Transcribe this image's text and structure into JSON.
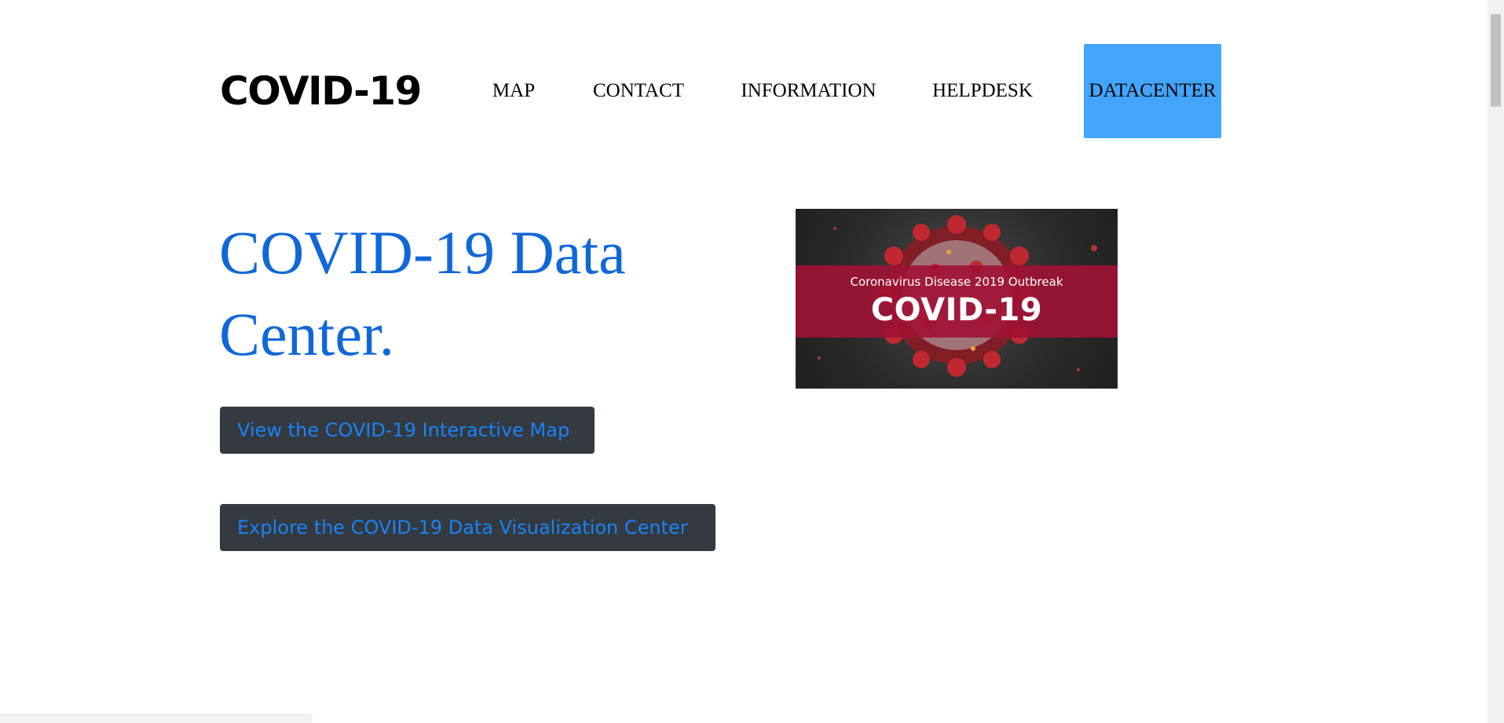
{
  "header": {
    "logo_text": "COVID-19",
    "nav": {
      "map": "MAP",
      "contact": "CONTACT",
      "information": "INFORMATION",
      "helpdesk": "HELPDESK",
      "datacenter": "DATACENTER"
    },
    "active_item_color": "#42a5fb"
  },
  "main": {
    "headline": "COVID-19 Data Center.",
    "headline_color": "#1068d8",
    "buttons": {
      "map": "View the COVID-19 Interactive Map",
      "visualization": "Explore the COVID-19 Data Visualization Center"
    },
    "button_bg": "#343a40",
    "button_text_color": "#1a82f7"
  },
  "banner": {
    "subtitle": "Coronavirus Disease 2019 Outbreak",
    "title": "COVID-19",
    "strip_color": "#a01234"
  }
}
